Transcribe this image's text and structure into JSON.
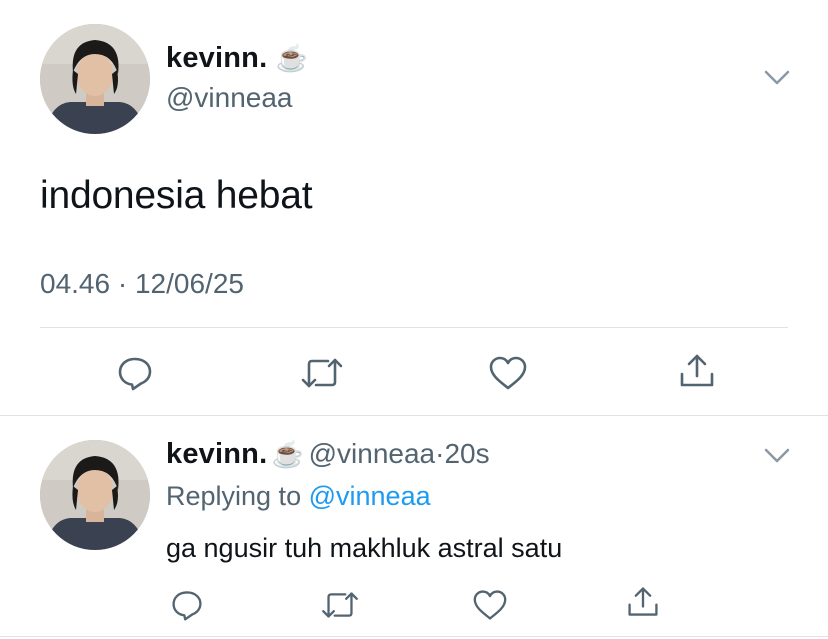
{
  "main_tweet": {
    "display_name": "kevinn.",
    "name_emoji": "☕",
    "handle": "@vinneaa",
    "text": "indonesia hebat",
    "time": "04.46",
    "separator": "·",
    "date": "12/06/25"
  },
  "actions": {
    "icons": [
      "reply-icon",
      "retweet-icon",
      "like-icon",
      "share-icon"
    ]
  },
  "reply_tweet": {
    "display_name": "kevinn.",
    "name_emoji": "☕",
    "handle": "@vinneaa",
    "separator": "·",
    "time_ago": "20s",
    "replying_prefix": "Replying to",
    "replying_handle": "@vinneaa",
    "text": "ga ngusir tuh makhluk astral satu"
  },
  "colors": {
    "text": "#0f1419",
    "secondary": "#536471",
    "link": "#1d9bf0",
    "divider": "#dfe3e6"
  }
}
